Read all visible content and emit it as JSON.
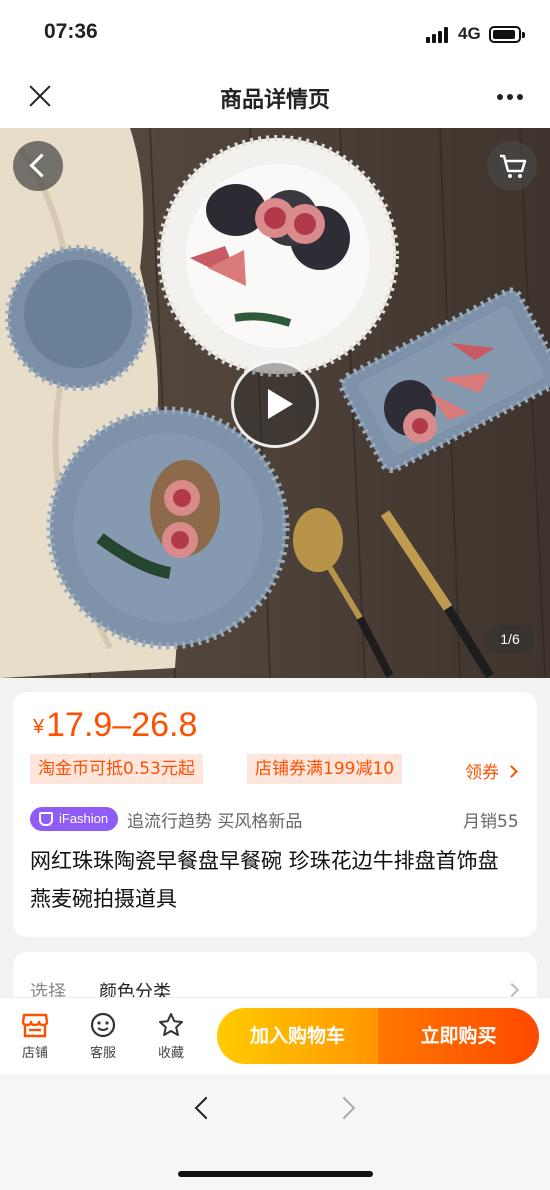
{
  "status_bar": {
    "time": "07:36",
    "network": "4G"
  },
  "nav": {
    "title": "商品详情页"
  },
  "gallery": {
    "page_indicator": "1/6"
  },
  "price": {
    "currency": "¥",
    "range": "17.9–26.8"
  },
  "promotions": {
    "coin_tag": "淘金币可抵0.53元起",
    "coupon_tag": "店铺券满199减10",
    "claim_label": "领券"
  },
  "brand": {
    "badge": "iFashion",
    "slogan": "追流行趋势 买风格新品",
    "monthly_sales": "月销55"
  },
  "product": {
    "title": "网红珠珠陶瓷早餐盘早餐碗 珍珠花边牛排盘首饰盘 燕麦碗拍摄道具"
  },
  "spec": {
    "label": "选择",
    "value": "颜色分类"
  },
  "actions": {
    "store": "店铺",
    "service": "客服",
    "favorite": "收藏",
    "add_to_cart": "加入购物车",
    "buy_now": "立即购买"
  },
  "colors": {
    "accent": "#ff5000",
    "cart_button": "#ffa800",
    "buy_button": "#ff5a00",
    "ifashion": "#8f5cf5"
  }
}
